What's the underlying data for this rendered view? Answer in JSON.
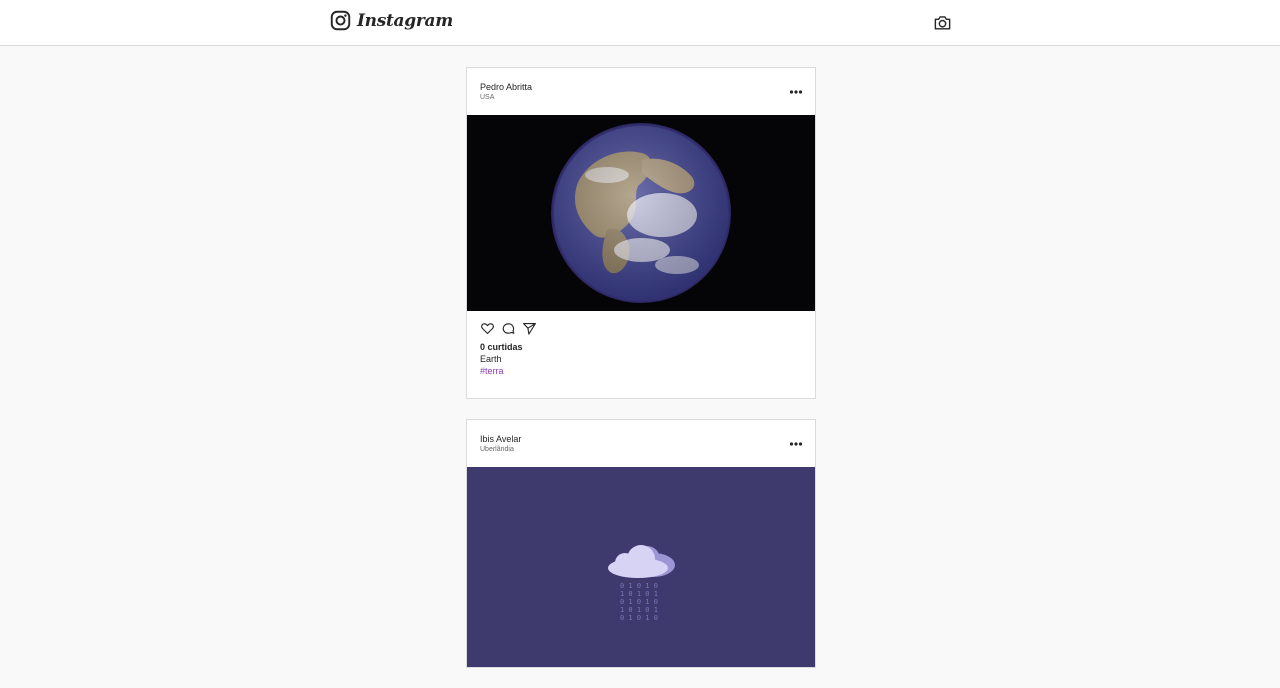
{
  "header": {
    "brand": "Instagram",
    "logo_icon": "instagram-glyph-icon",
    "camera_icon": "camera-icon"
  },
  "posts": [
    {
      "username": "Pedro Abritta",
      "location": "USA",
      "image": "earth-photo",
      "likes": "0 curtidas",
      "caption": "Earth",
      "hashtag": "#terra"
    },
    {
      "username": "Ibis Avelar",
      "location": "Uberlândia",
      "image": "cloud-computing-illustration"
    }
  ],
  "icons": {
    "more": "more-options-icon",
    "like": "heart-icon",
    "comment": "comment-icon",
    "share": "send-icon"
  },
  "colors": {
    "background": "#f9f9f9",
    "card": "#ffffff",
    "border": "#dbdbdb",
    "hashtag": "#8a3ab9",
    "cloud_bg": "#3f3a6e"
  }
}
